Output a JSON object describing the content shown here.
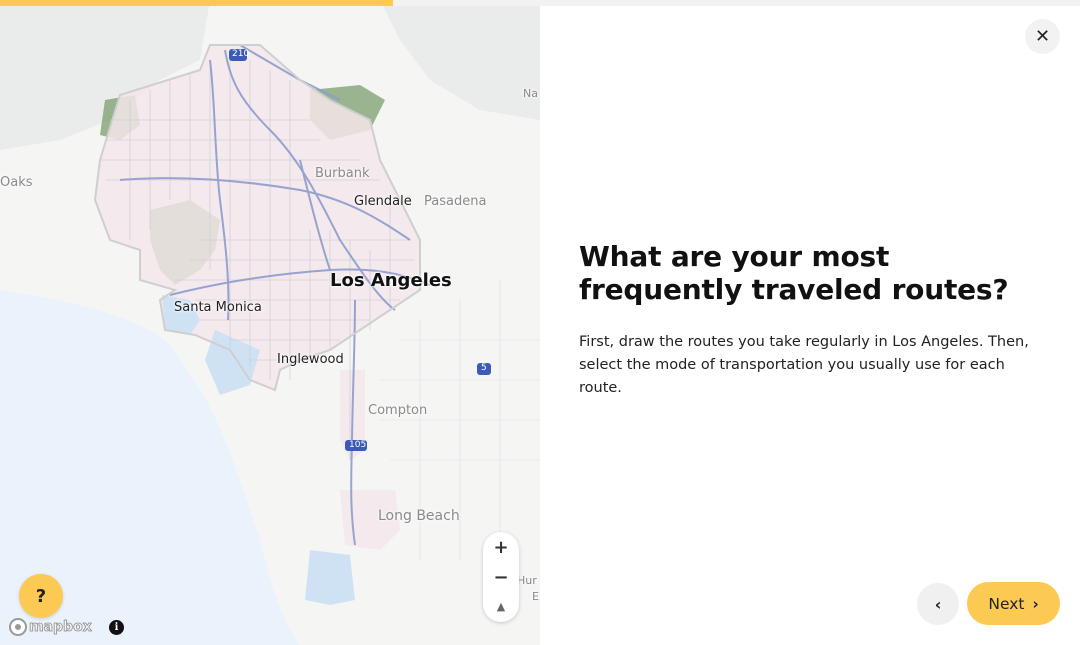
{
  "progress": {
    "fraction": 0.364
  },
  "colors": {
    "accent": "#fcc953",
    "route": "#8e9ccc",
    "park": "#7a9e6e",
    "water": "#cfe2f3",
    "city_area": "#f3e6ea"
  },
  "map": {
    "labels": {
      "los_angeles": "Los Angeles",
      "burbank": "Burbank",
      "glendale": "Glendale",
      "pasadena": "Pasadena",
      "santa_monica": "Santa Monica",
      "inglewood": "Inglewood",
      "compton": "Compton",
      "long_beach": "Long Beach",
      "oaks": "Oaks",
      "na": "Na",
      "hur": "Hur",
      "e": "E"
    },
    "shields": {
      "i210": "210",
      "i105": "105",
      "i5": "5"
    },
    "controls": {
      "zoom_in": "+",
      "zoom_out": "−",
      "compass": "▲"
    },
    "attribution": {
      "logo_text": "mapbox",
      "info": "i"
    }
  },
  "help": {
    "label": "?"
  },
  "content": {
    "title": "What are your most frequently traveled routes?",
    "description": "First, draw the routes you take regularly in Los Angeles. Then, select the mode of transportation you usually use for each route.",
    "close_label": "✕",
    "back_label": "‹",
    "next_label": "Next",
    "next_chevron": "›"
  },
  "icons": {
    "close": "close-icon",
    "back": "chevron-left-icon",
    "next": "chevron-right-icon",
    "help": "question-icon",
    "info": "info-icon"
  }
}
